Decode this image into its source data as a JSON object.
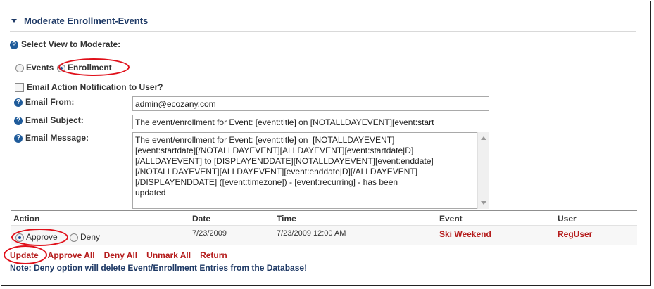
{
  "section": {
    "title": "Moderate Enrollment-Events"
  },
  "view_select": {
    "label": "Select View to Moderate:",
    "options": [
      "Events",
      "Enrollment"
    ],
    "selected": "Enrollment"
  },
  "notify": {
    "label": "Email Action Notification to User?",
    "checked": false
  },
  "email_from": {
    "label": "Email From:",
    "value": "admin@ecozany.com"
  },
  "email_subject": {
    "label": "Email Subject:",
    "value": "The event/enrollment for Event: [event:title] on [NOTALLDAYEVENT][event:start"
  },
  "email_message": {
    "label": "Email Message:",
    "value": "The event/enrollment for Event: [event:title] on  [NOTALLDAYEVENT]\n[event:startdate][/NOTALLDAYEVENT][ALLDAYEVENT][event:startdate|D]\n[/ALLDAYEVENT] to [DISPLAYENDDATE][NOTALLDAYEVENT][event:enddate]\n[/NOTALLDAYEVENT][ALLDAYEVENT][event:enddate|D][/ALLDAYEVENT]\n[/DISPLAYENDDATE] ([event:timezone]) - [event:recurring] - has been\nupdated"
  },
  "grid": {
    "headers": {
      "action": "Action",
      "date": "Date",
      "time": "Time",
      "event": "Event",
      "user": "User"
    },
    "rows": [
      {
        "approve": "Approve",
        "deny": "Deny",
        "selected": "Approve",
        "date": "7/23/2009",
        "time": "7/23/2009 12:00 AM",
        "event": "Ski Weekend",
        "user": "RegUser"
      }
    ]
  },
  "commands": {
    "update": "Update",
    "approve_all": "Approve All",
    "deny_all": "Deny All",
    "unmark_all": "Unmark All",
    "return": "Return"
  },
  "note": "Note: Deny option will delete Event/Enrollment Entries from the Database!",
  "help_icon": "help-question-icon",
  "colors": {
    "accent": "#1f3a66",
    "link": "#b51c1c",
    "highlight": "#e0101a"
  }
}
